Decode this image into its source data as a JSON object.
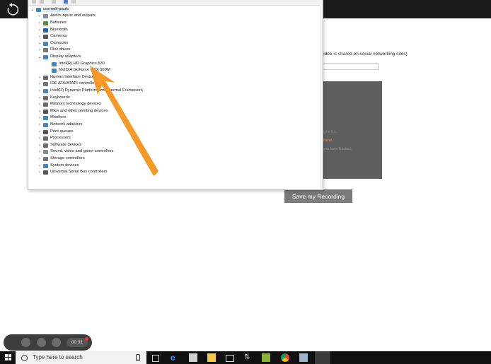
{
  "device_manager": {
    "root_label": "cos-nok-paulc",
    "items": [
      {
        "label": "Audio inputs and outputs",
        "expanded": false,
        "color": "#7d8fa3"
      },
      {
        "label": "Batteries",
        "expanded": false,
        "color": "#5a8a3c"
      },
      {
        "label": "Bluetooth",
        "expanded": false,
        "color": "#1565c0"
      },
      {
        "label": "Cameras",
        "expanded": false,
        "color": "#555555"
      },
      {
        "label": "Computer",
        "expanded": false,
        "color": "#3c88c8"
      },
      {
        "label": "Disk drives",
        "expanded": false,
        "color": "#777777"
      },
      {
        "label": "Display adapters",
        "expanded": true,
        "color": "#3c88c8"
      },
      {
        "label": "Intel(R) HD Graphics 530",
        "child": true,
        "color": "#3c88c8"
      },
      {
        "label": "NVIDIA GeForce GTX 960M",
        "child": true,
        "color": "#3c88c8"
      },
      {
        "label": "Human Interface Devices",
        "expanded": false,
        "color": "#6a6a6a"
      },
      {
        "label": "IDE ATA/ATAPI controllers",
        "expanded": false,
        "color": "#777777"
      },
      {
        "label": "Intel(R) Dynamic Platform and Thermal Framework",
        "expanded": false,
        "color": "#3c88c8"
      },
      {
        "label": "Keyboards",
        "expanded": false,
        "color": "#6a6a6a"
      },
      {
        "label": "Memory technology devices",
        "expanded": false,
        "color": "#6a6a6a"
      },
      {
        "label": "Mice and other pointing devices",
        "expanded": false,
        "color": "#555555"
      },
      {
        "label": "Monitors",
        "expanded": false,
        "color": "#3c88c8"
      },
      {
        "label": "Network adapters",
        "expanded": false,
        "color": "#3c88c8"
      },
      {
        "label": "Print queues",
        "expanded": false,
        "color": "#555555"
      },
      {
        "label": "Processors",
        "expanded": false,
        "color": "#6a6a6a"
      },
      {
        "label": "Software devices",
        "expanded": false,
        "color": "#6a6a6a"
      },
      {
        "label": "Sound, video and game controllers",
        "expanded": false,
        "color": "#7d8fa3"
      },
      {
        "label": "Storage controllers",
        "expanded": false,
        "color": "#777777"
      },
      {
        "label": "System devices",
        "expanded": false,
        "color": "#3c88c8"
      },
      {
        "label": "Universal Serial Bus controllers",
        "expanded": false,
        "color": "#555555"
      }
    ]
  },
  "web_form": {
    "share_text": "video is shared on social networking sites)",
    "player_line1": "gress.",
    "player_line2": "how.",
    "player_line3": "you have finished.",
    "save_button": "Save my Recording"
  },
  "recorder": {
    "timer": "00:31"
  },
  "taskbar": {
    "search_placeholder": "Type here to search"
  },
  "colors": {
    "arrow": "#f7941d",
    "accent_orange": "#e0782a"
  }
}
